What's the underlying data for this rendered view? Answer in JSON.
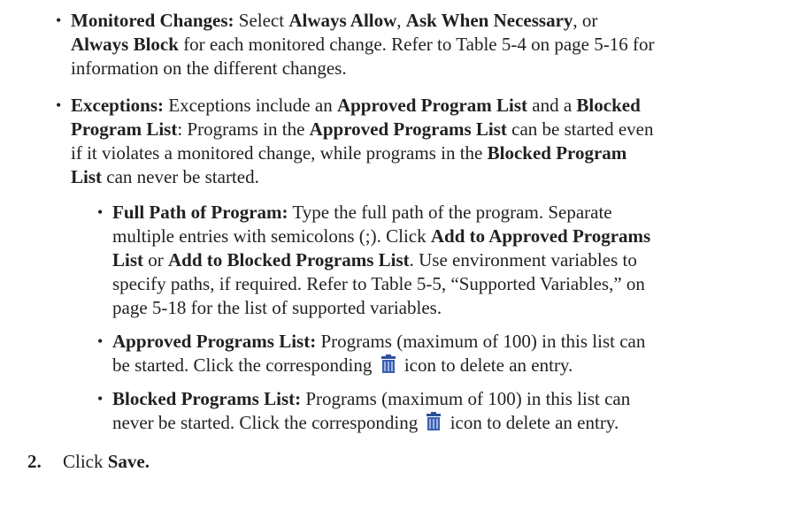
{
  "monitored": {
    "l1a": "Monitored Changes:",
    "l1b": " Select ",
    "l1c": "Always Allow",
    "l1d": ", ",
    "l1e": "Ask When Necessary",
    "l1f": ", or",
    "l2a": "Always Block",
    "l2b": " for each monitored change. Refer to Table 5-4 on page 5-16 for",
    "l3": "information on the different changes."
  },
  "exceptions": {
    "l1a": "Exceptions:",
    "l1b": " Exceptions include an ",
    "l1c": "Approved Program List",
    "l1d": " and a ",
    "l1e": "Blocked",
    "l2a": "Program List",
    "l2b": ": Programs in the ",
    "l2c": "Approved Programs List",
    "l2d": " can be started even",
    "l3": "if it violates a monitored change, while programs in the ",
    "l3b": "Blocked Program",
    "l4a": "List",
    "l4b": " can never be started."
  },
  "fullpath": {
    "l1a": "Full Path of Program:",
    "l1b": " Type the full path of the program. Separate",
    "l2a": "multiple entries with semicolons (;). Click ",
    "l2b": "Add to Approved Programs",
    "l3a": "List",
    "l3b": " or ",
    "l3c": "Add to Blocked Programs List",
    "l3d": ". Use environment variables to",
    "l4": "specify paths, if required. Refer to Table 5-5, “Supported Variables,” on",
    "l5": "page 5-18 for the list of supported variables."
  },
  "approved": {
    "l1a": "Approved Programs List:",
    "l1b": " Programs (maximum of 100) in this list can",
    "l2a": "be started. Click the corresponding ",
    "l2b": " icon to delete an entry."
  },
  "blocked": {
    "l1a": "Blocked Programs List:",
    "l1b": " Programs (maximum of 100) in this list can",
    "l2a": "never be started. Click the corresponding ",
    "l2b": " icon to delete an entry."
  },
  "step2": {
    "number": "2.",
    "a": "Click ",
    "b": "Save."
  },
  "bullet_char": "•",
  "colors": {
    "text": "#231f20",
    "trash_icon": "#3a5fb0"
  }
}
